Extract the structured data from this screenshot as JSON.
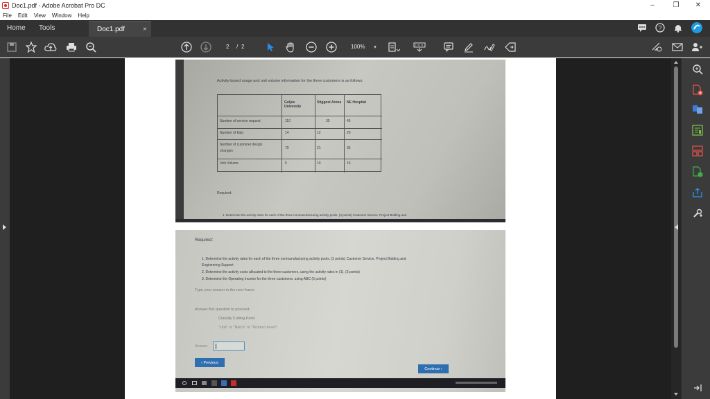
{
  "window": {
    "title": "Doc1.pdf - Adobe Acrobat Pro DC",
    "min": "–",
    "max": "❐",
    "close": "✕"
  },
  "menu": [
    "File",
    "Edit",
    "View",
    "Window",
    "Help"
  ],
  "tabs": {
    "home": "Home",
    "tools": "Tools",
    "doc": "Doc1.pdf",
    "close": "×"
  },
  "toolbar": {
    "page_current": "2",
    "page_sep": "/",
    "page_total": "2",
    "zoom": "100%"
  },
  "page1": {
    "heading": "Activity-based usage and unit volume information for the three customers is as follows:",
    "table": {
      "headers": [
        "",
        "Goljes University",
        "Stiggest Arena",
        "NE Hospital"
      ],
      "rows": [
        [
          "Number of service request",
          "110",
          "35",
          "45"
        ],
        [
          "Number of bids",
          "14",
          "12",
          "20"
        ],
        [
          "Number of customer design changes",
          "70",
          "21",
          "35"
        ],
        [
          "Unit Volume",
          "5",
          "10",
          "15"
        ]
      ]
    },
    "required": "Required:",
    "item1": "1. Determine the activity rates for each of the three nonmanufacturing activity pools. (3 points) Customer Service, Project Bidding and"
  },
  "page2": {
    "required": "Required:",
    "items": [
      "1. Determine the activity rates for each of the three nonmanufacturing activity pools. (3 points) Customer Service, Project Bidding and",
      "Engineering Support",
      "2. Determine the activity costs allocated to the three customers, using the activity rates in (1). (3 points)",
      "3. Determine the Operating Income for the three customers, using ABC (5 points)"
    ],
    "type_prompt": "Type your answer in the next frame",
    "answer_prompt": "Answer this question to proceed:",
    "classify": "Classify Cutting Parts",
    "levels": "\"Unit\" or \"Batch\" or \"Product level?",
    "answer_label": "Answer",
    "prev_button": "‹ Previous",
    "continue_button": "Continue ›"
  }
}
